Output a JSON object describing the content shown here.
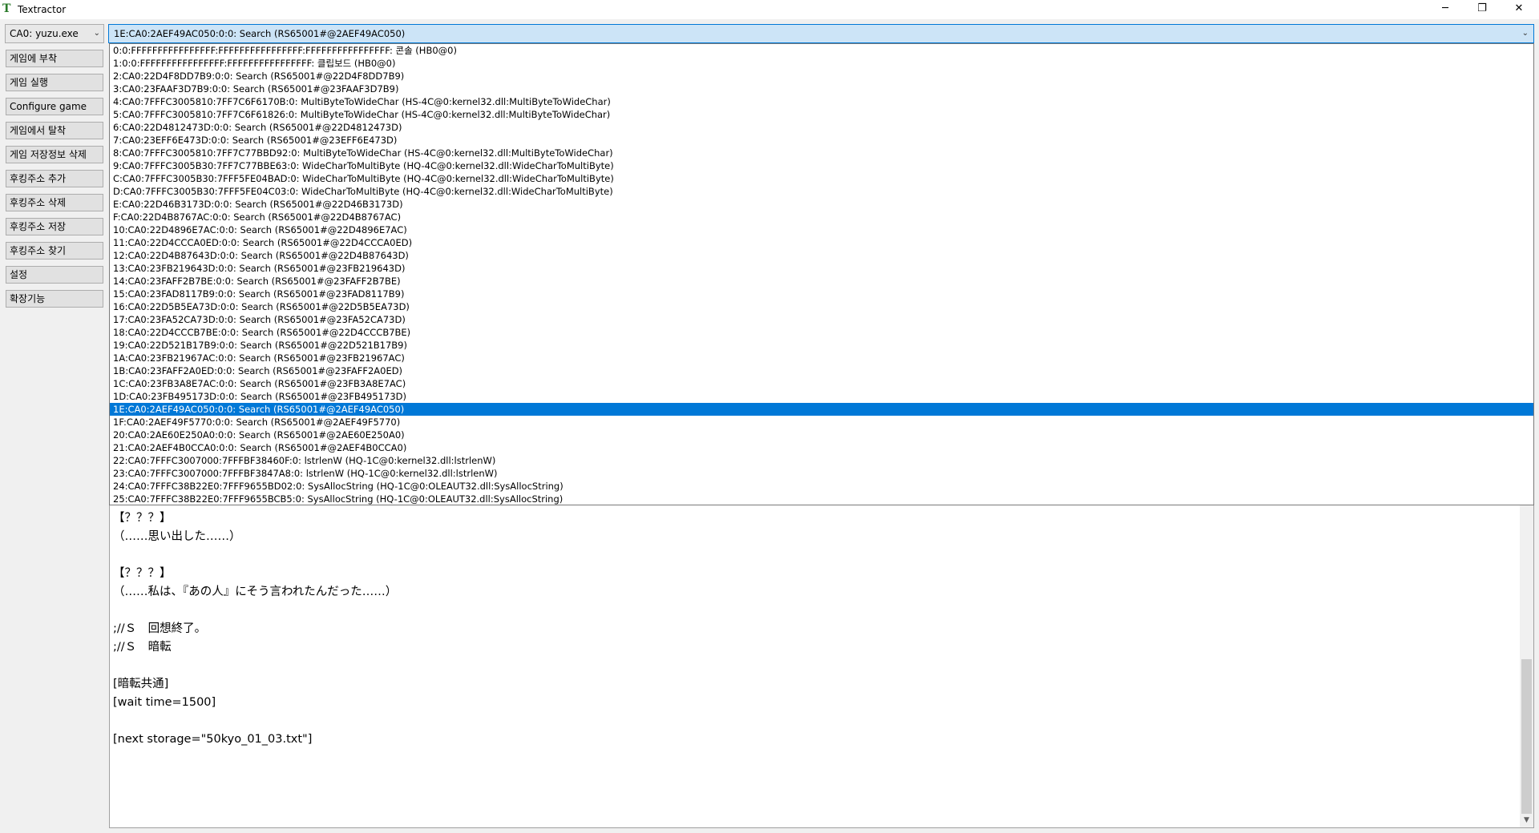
{
  "window": {
    "title": "Textractor",
    "icon_glyph": "T",
    "minimize_glyph": "─",
    "maximize_glyph": "❐",
    "close_glyph": "✕"
  },
  "sidebar": {
    "process_selected": "CA0: yuzu.exe",
    "buttons": [
      "게임에 부착",
      "게임 실행",
      "Configure game",
      "게임에서 탈착",
      "게임 저장정보 삭제",
      "후킹주소 추가",
      "후킹주소 삭제",
      "후킹주소 저장",
      "후킹주소 찾기",
      "설정",
      "확장기능"
    ]
  },
  "hook_combo": {
    "selected": "1E:CA0:2AEF49AC050:0:0: Search (RS65001#@2AEF49AC050)",
    "items": [
      "0:0:FFFFFFFFFFFFFFFF:FFFFFFFFFFFFFFFF:FFFFFFFFFFFFFFFF: 콘솔 (HB0@0)",
      "1:0:0:FFFFFFFFFFFFFFFF:FFFFFFFFFFFFFFFF: 클립보드 (HB0@0)",
      "2:CA0:22D4F8DD7B9:0:0: Search (RS65001#@22D4F8DD7B9)",
      "3:CA0:23FAAF3D7B9:0:0: Search (RS65001#@23FAAF3D7B9)",
      "4:CA0:7FFFC3005810:7FF7C6F6170B:0: MultiByteToWideChar (HS-4C@0:kernel32.dll:MultiByteToWideChar)",
      "5:CA0:7FFFC3005810:7FF7C6F61826:0: MultiByteToWideChar (HS-4C@0:kernel32.dll:MultiByteToWideChar)",
      "6:CA0:22D4812473D:0:0: Search (RS65001#@22D4812473D)",
      "7:CA0:23EFF6E473D:0:0: Search (RS65001#@23EFF6E473D)",
      "8:CA0:7FFFC3005810:7FF7C77BBD92:0: MultiByteToWideChar (HS-4C@0:kernel32.dll:MultiByteToWideChar)",
      "9:CA0:7FFFC3005B30:7FF7C77BBE63:0: WideCharToMultiByte (HQ-4C@0:kernel32.dll:WideCharToMultiByte)",
      "C:CA0:7FFFC3005B30:7FFF5FE04BAD:0: WideCharToMultiByte (HQ-4C@0:kernel32.dll:WideCharToMultiByte)",
      "D:CA0:7FFFC3005B30:7FFF5FE04C03:0: WideCharToMultiByte (HQ-4C@0:kernel32.dll:WideCharToMultiByte)",
      "E:CA0:22D46B3173D:0:0: Search (RS65001#@22D46B3173D)",
      "F:CA0:22D4B8767AC:0:0: Search (RS65001#@22D4B8767AC)",
      "10:CA0:22D4896E7AC:0:0: Search (RS65001#@22D4896E7AC)",
      "11:CA0:22D4CCCA0ED:0:0: Search (RS65001#@22D4CCCA0ED)",
      "12:CA0:22D4B87643D:0:0: Search (RS65001#@22D4B87643D)",
      "13:CA0:23FB219643D:0:0: Search (RS65001#@23FB219643D)",
      "14:CA0:23FAFF2B7BE:0:0: Search (RS65001#@23FAFF2B7BE)",
      "15:CA0:23FAD8117B9:0:0: Search (RS65001#@23FAD8117B9)",
      "16:CA0:22D5B5EA73D:0:0: Search (RS65001#@22D5B5EA73D)",
      "17:CA0:23FA52CA73D:0:0: Search (RS65001#@23FA52CA73D)",
      "18:CA0:22D4CCCB7BE:0:0: Search (RS65001#@22D4CCCB7BE)",
      "19:CA0:22D521B17B9:0:0: Search (RS65001#@22D521B17B9)",
      "1A:CA0:23FB21967AC:0:0: Search (RS65001#@23FB21967AC)",
      "1B:CA0:23FAFF2A0ED:0:0: Search (RS65001#@23FAFF2A0ED)",
      "1C:CA0:23FB3A8E7AC:0:0: Search (RS65001#@23FB3A8E7AC)",
      "1D:CA0:23FB495173D:0:0: Search (RS65001#@23FB495173D)",
      "1E:CA0:2AEF49AC050:0:0: Search (RS65001#@2AEF49AC050)",
      "1F:CA0:2AEF49F5770:0:0: Search (RS65001#@2AEF49F5770)",
      "20:CA0:2AE60E250A0:0:0: Search (RS65001#@2AE60E250A0)",
      "21:CA0:2AEF4B0CCA0:0:0: Search (RS65001#@2AEF4B0CCA0)",
      "22:CA0:7FFFC3007000:7FFFBF38460F:0: lstrlenW (HQ-1C@0:kernel32.dll:lstrlenW)",
      "23:CA0:7FFFC3007000:7FFFBF3847A8:0: lstrlenW (HQ-1C@0:kernel32.dll:lstrlenW)",
      "24:CA0:7FFFC38B22E0:7FFF9655BD02:0: SysAllocString (HQ-1C@0:OLEAUT32.dll:SysAllocString)",
      "25:CA0:7FFFC38B22E0:7FFF9655BCB5:0: SysAllocString (HQ-1C@0:OLEAUT32.dll:SysAllocString)"
    ],
    "selected_index": 28
  },
  "text_output": {
    "lines": [
      "【？？？】",
      "（……思い出した……）",
      "",
      "【？？？】",
      "（……私は、『あの人』にそう言われたんだった……）",
      "",
      ";//Ｓ　回想終了。",
      ";//Ｓ　暗転",
      "",
      "[暗転共通]",
      "[wait time=1500]",
      "",
      "[next storage=\"50kyo_01_03.txt\"]"
    ],
    "scroll_down_glyph": "▼"
  }
}
